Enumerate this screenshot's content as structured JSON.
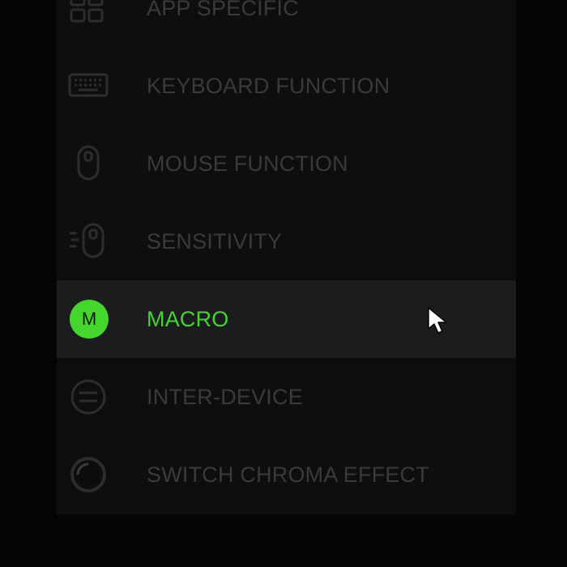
{
  "menu": {
    "items": [
      {
        "label": "APP SPECIFIC",
        "icon": "app-specific-icon"
      },
      {
        "label": "KEYBOARD FUNCTION",
        "icon": "keyboard-icon"
      },
      {
        "label": "MOUSE FUNCTION",
        "icon": "mouse-icon"
      },
      {
        "label": "SENSITIVITY",
        "icon": "sensitivity-icon"
      },
      {
        "label": "MACRO",
        "icon": "macro-icon",
        "badge": "M",
        "selected": true
      },
      {
        "label": "INTER-DEVICE",
        "icon": "inter-device-icon"
      },
      {
        "label": "SWITCH CHROMA EFFECT",
        "icon": "chroma-effect-icon"
      }
    ]
  },
  "colors": {
    "accent": "#44d62c",
    "dim_text": "#3a3a3a",
    "panel": "#0d0e0f",
    "selected_row": "#1b1c1d"
  }
}
